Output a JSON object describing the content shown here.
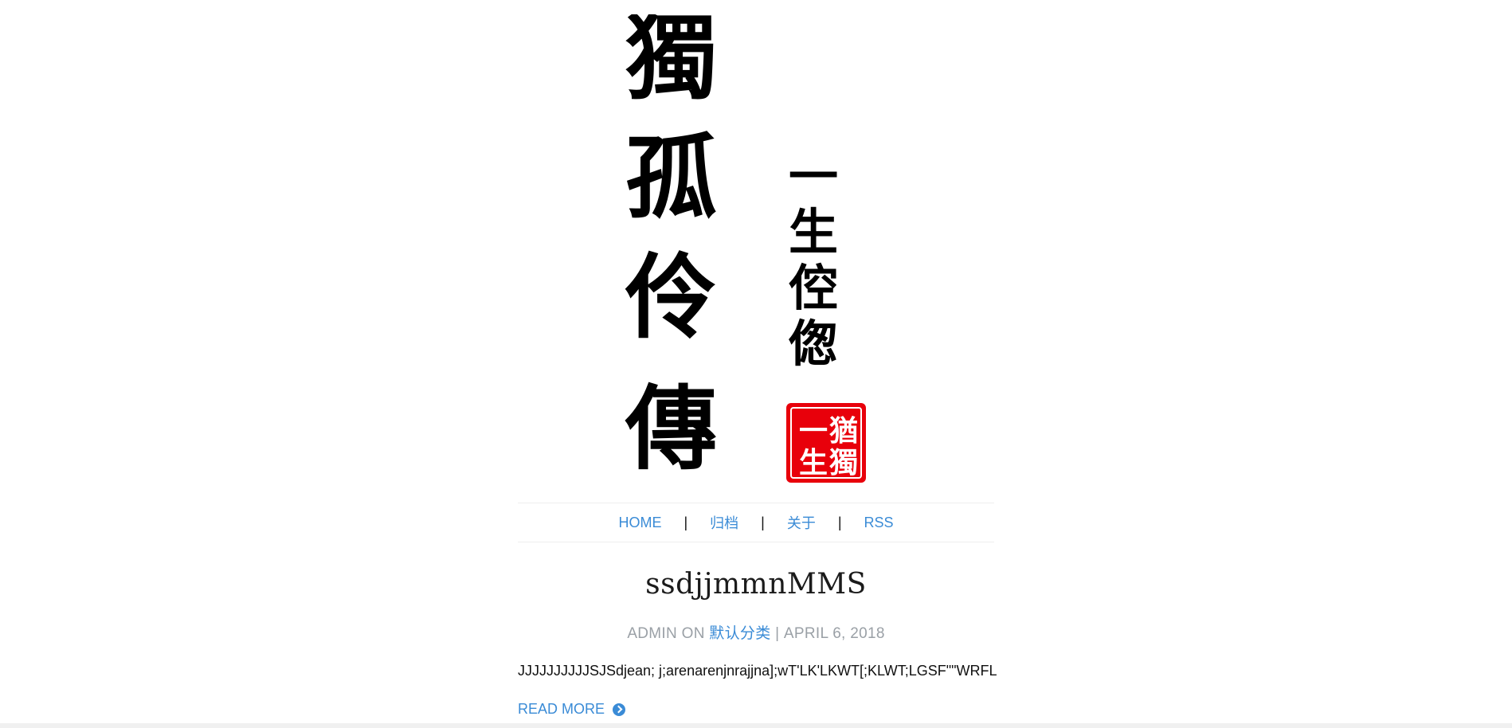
{
  "logo": {
    "main_text": [
      "獨",
      "孤",
      "伶",
      "傳"
    ],
    "side_text": [
      "一",
      "生",
      "倥",
      "偬"
    ],
    "seal_text": [
      "一",
      "生",
      "猶",
      "獨"
    ],
    "seal_color": "#e8000b"
  },
  "nav": {
    "items": [
      {
        "label": "HOME"
      },
      {
        "label": "归档"
      },
      {
        "label": "关于"
      },
      {
        "label": "RSS"
      }
    ],
    "separator": "|"
  },
  "post": {
    "title": "ssdjjmmnMMS",
    "meta_prefix": "ADMIN ON ",
    "category": "默认分类",
    "meta_sep": " | ",
    "date": "APRIL 6, 2018",
    "excerpt": "JJJJJJJJJJSJSdjean; j;arenarenjnrajjna];wT'LK'LKWT[;KLWT;LGSF\"\"WRFL",
    "read_more": "READ MORE"
  },
  "colors": {
    "link": "#3a8bd6",
    "meta": "#9aa0a6"
  }
}
